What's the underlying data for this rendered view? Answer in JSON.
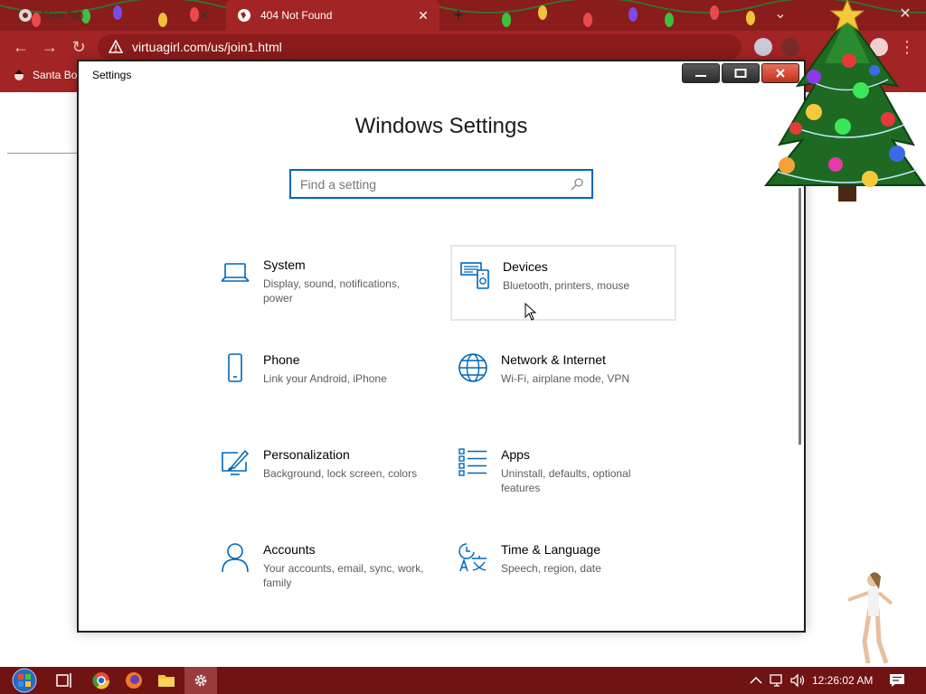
{
  "browser": {
    "tabs": [
      {
        "title": "New Tab",
        "active": false
      },
      {
        "title": "404 Not Found",
        "active": true
      }
    ],
    "url": "virtuagirl.com/us/join1.html",
    "bookmark_label": "Santa Bo",
    "colors": {
      "chrome": "#a32424",
      "tabstrip": "#8a1c1c"
    }
  },
  "settings": {
    "window_title": "Settings",
    "heading": "Windows Settings",
    "search_placeholder": "Find a setting",
    "accent": "#0067b8",
    "categories": [
      {
        "title": "System",
        "desc": "Display, sound, notifications, power",
        "icon": "laptop-icon"
      },
      {
        "title": "Devices",
        "desc": "Bluetooth, printers, mouse",
        "icon": "devices-icon"
      },
      {
        "title": "Phone",
        "desc": "Link your Android, iPhone",
        "icon": "phone-icon"
      },
      {
        "title": "Network & Internet",
        "desc": "Wi-Fi, airplane mode, VPN",
        "icon": "globe-icon"
      },
      {
        "title": "Personalization",
        "desc": "Background, lock screen, colors",
        "icon": "paint-icon"
      },
      {
        "title": "Apps",
        "desc": "Uninstall, defaults, optional features",
        "icon": "apps-list-icon"
      },
      {
        "title": "Accounts",
        "desc": "Your accounts, email, sync, work, family",
        "icon": "person-icon"
      },
      {
        "title": "Time & Language",
        "desc": "Speech, region, date",
        "icon": "time-language-icon"
      }
    ]
  },
  "taskbar": {
    "clock": "12:26:02 AM",
    "colors": {
      "background": "#6f1313"
    }
  }
}
